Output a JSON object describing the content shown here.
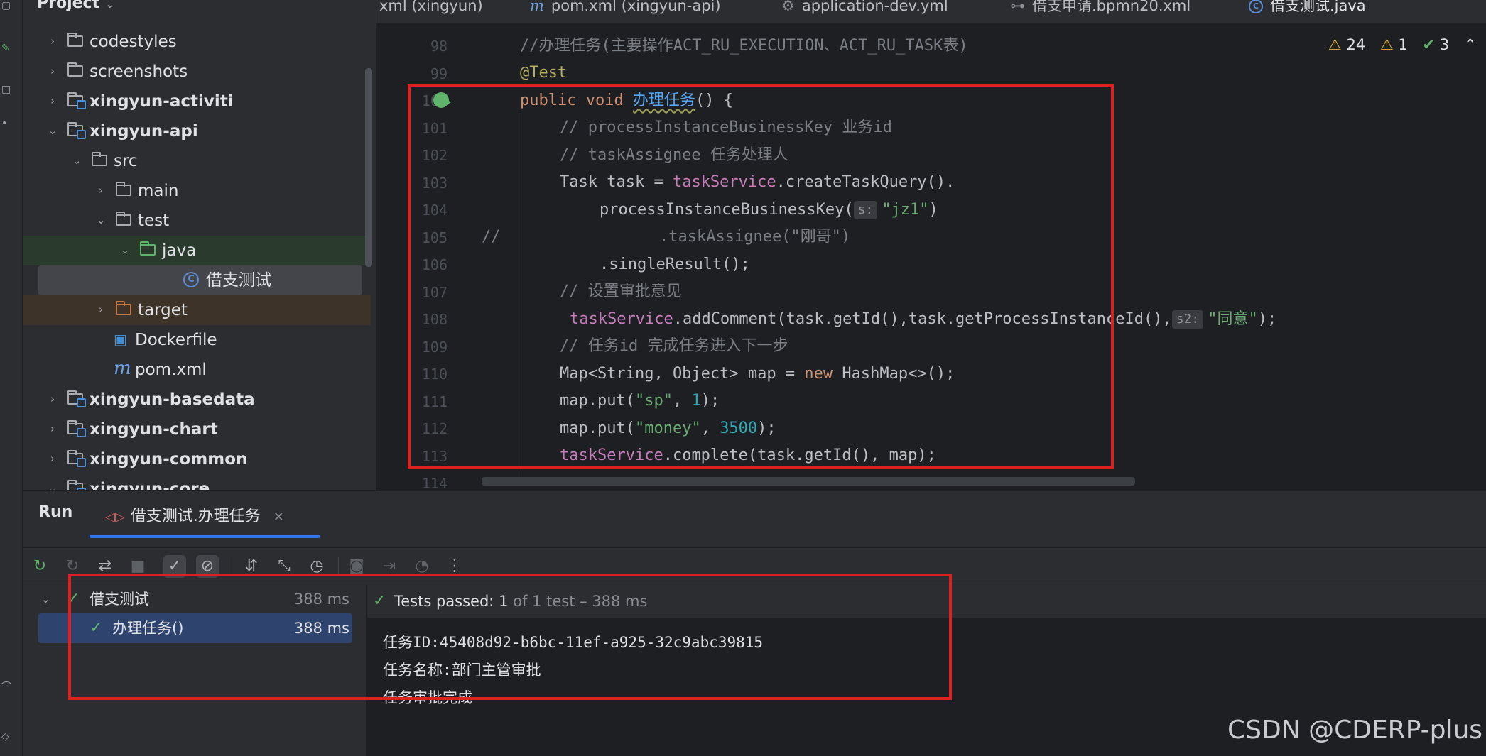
{
  "project_panel": {
    "title": "Project",
    "items": [
      {
        "label": "codestyles",
        "type": "folder"
      },
      {
        "label": "screenshots",
        "type": "folder"
      },
      {
        "label": "xingyun-activiti",
        "type": "module"
      },
      {
        "label": "xingyun-api",
        "type": "module"
      },
      {
        "label": "src",
        "type": "folder"
      },
      {
        "label": "main",
        "type": "folder"
      },
      {
        "label": "test",
        "type": "folder"
      },
      {
        "label": "java",
        "type": "test-sources-folder"
      },
      {
        "label": "借支测试",
        "type": "class"
      },
      {
        "label": "target",
        "type": "excluded-folder"
      },
      {
        "label": "Dockerfile",
        "type": "docker-file"
      },
      {
        "label": "pom.xml",
        "type": "maven-file"
      },
      {
        "label": "xingyun-basedata",
        "type": "module"
      },
      {
        "label": "xingyun-chart",
        "type": "module"
      },
      {
        "label": "xingyun-common",
        "type": "module"
      },
      {
        "label": "xingyun-core",
        "type": "module"
      }
    ]
  },
  "editor_tabs": [
    {
      "label": "xml (xingyun)",
      "icon": "xml-file-icon"
    },
    {
      "label": "pom.xml (xingyun-api)",
      "icon": "maven-icon"
    },
    {
      "label": "application-dev.yml",
      "icon": "spring-config-icon"
    },
    {
      "label": "借支申请.bpmn20.xml",
      "icon": "bpmn-icon"
    },
    {
      "label": "借支测试.java",
      "icon": "java-class-icon",
      "active": true
    }
  ],
  "inspections": {
    "warnings": "24",
    "weak_warnings": "1",
    "typos": "3"
  },
  "code": {
    "line_numbers": [
      "98",
      "99",
      "100",
      "101",
      "102",
      "103",
      "104",
      "105",
      "106",
      "107",
      "108",
      "109",
      "110",
      "111",
      "112",
      "113",
      "114"
    ],
    "line98_comment": "//办理任务(主要操作ACT_RU_EXECUTION、ACT_RU_TASK表)",
    "line99_annotation": "@Test",
    "line100": {
      "kw1": "public",
      "kw2": "void",
      "method": "办理任务",
      "rest": "() {"
    },
    "line101_comment": "// processInstanceBusinessKey 业务id",
    "line102_comment": "// taskAssignee 任务处理人",
    "line103": {
      "pre": "Task task = ",
      "field": "taskService",
      "post": ".createTaskQuery()."
    },
    "line104": {
      "pre": "processInstanceBusinessKey(",
      "hint": "s:",
      "str": "\"jz1\"",
      "post": ")"
    },
    "line105": {
      "prefix": "//",
      "text": ".taskAssignee(\"刚哥\")"
    },
    "line106": ".singleResult();",
    "line107_comment": "// 设置审批意见",
    "line108": {
      "field": "taskService",
      "pre": ".addComment(task.getId(),task.getProcessInstanceId(),",
      "hint": "s2:",
      "str": "\"同意\"",
      "post": ");"
    },
    "line109_comment": "// 任务id 完成任务进入下一步",
    "line110": {
      "pre": "Map<String, Object> map = ",
      "kw": "new",
      "post": " HashMap<>();"
    },
    "line111": {
      "pre": "map.put(",
      "str": "\"sp\"",
      "mid": ", ",
      "num": "1",
      "post": ");"
    },
    "line112": {
      "pre": "map.put(",
      "str": "\"money\"",
      "mid": ", ",
      "num": "3500",
      "post": ");"
    },
    "line113": {
      "field": "taskService",
      "post": ".complete(task.getId(), map);"
    }
  },
  "run_panel": {
    "title": "Run",
    "tab_label": "借支测试.办理任务",
    "tree": [
      {
        "name": "借支测试",
        "time": "388 ms"
      },
      {
        "name": "办理任务()",
        "time": "388 ms"
      }
    ],
    "status_label": "Tests passed:",
    "status_count": "1",
    "status_rest": "of 1 test – 388 ms",
    "output": [
      "任务ID:45408d92-b6bc-11ef-a925-32c9abc39815",
      "任务名称:部门主管审批",
      "任务审批完成"
    ]
  },
  "watermark": "CSDN @CDERP-plus",
  "colors": {
    "annotation_box": "#e02020",
    "accent": "#3574f0",
    "success": "#5fb36a"
  }
}
